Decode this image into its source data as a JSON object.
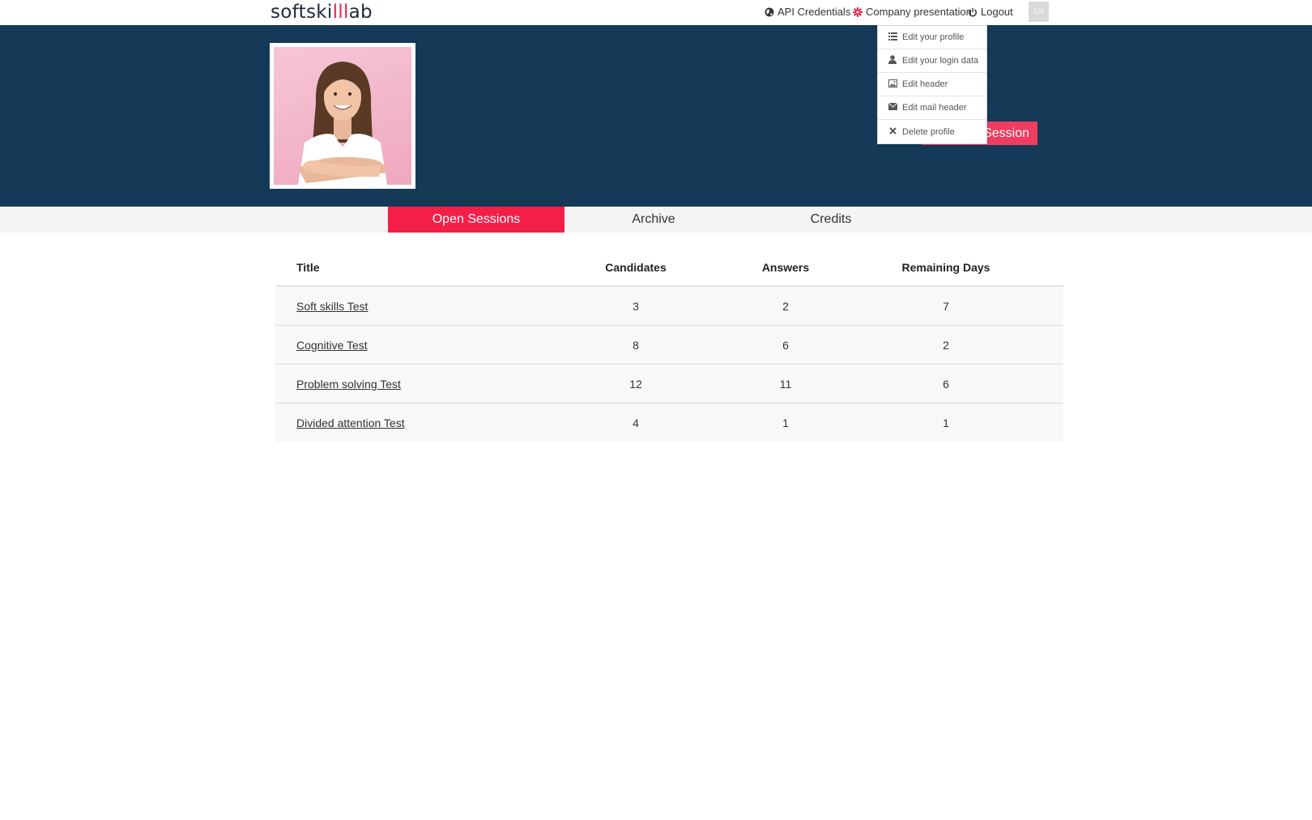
{
  "brand": {
    "logo_prefix": "softski",
    "logo_accent": "lll",
    "logo_suffix": "ab",
    "accent_color": "#f0244a",
    "hero_color": "#143a57"
  },
  "topnav": {
    "api_label": "API Credentials",
    "company_label": "Company presentation",
    "logout_label": "Logout",
    "language": "EN"
  },
  "dropdown": {
    "items": [
      {
        "icon": "list-icon",
        "label": "Edit your profile"
      },
      {
        "icon": "user-icon",
        "label": "Edit your login data"
      },
      {
        "icon": "image-icon",
        "label": "Edit header"
      },
      {
        "icon": "envelope-icon",
        "label": "Edit mail header"
      },
      {
        "icon": "close-icon",
        "label": "Delete profile"
      }
    ]
  },
  "hero": {
    "new_session_label": "Session"
  },
  "tabs": [
    {
      "label": "Open Sessions",
      "active": true
    },
    {
      "label": "Archive",
      "active": false
    },
    {
      "label": "Credits",
      "active": false
    }
  ],
  "table": {
    "headers": {
      "title": "Title",
      "candidates": "Candidates",
      "answers": "Answers",
      "remaining_days": "Remaining Days"
    },
    "rows": [
      {
        "title": "Soft skills Test",
        "candidates": "3",
        "answers": "2",
        "remaining_days": "7"
      },
      {
        "title": "Cognitive Test",
        "candidates": "8",
        "answers": "6",
        "remaining_days": "2"
      },
      {
        "title": "Problem solving Test",
        "candidates": "12",
        "answers": "11",
        "remaining_days": "6"
      },
      {
        "title": "Divided attention Test",
        "candidates": "4",
        "answers": "1",
        "remaining_days": "1"
      }
    ]
  }
}
